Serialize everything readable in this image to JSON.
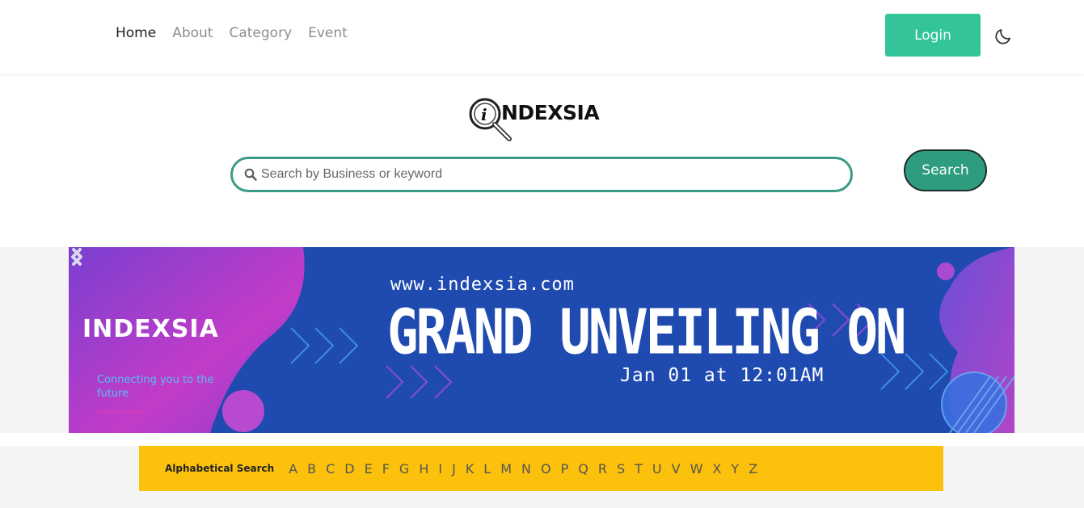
{
  "nav": {
    "items": [
      {
        "label": "Home",
        "active": true
      },
      {
        "label": "About",
        "active": false
      },
      {
        "label": "Category",
        "active": false
      },
      {
        "label": "Event",
        "active": false
      }
    ],
    "login_label": "Login",
    "theme_icon": "moon-icon"
  },
  "logo": {
    "text": "NDEXSIA",
    "icon": "magnifier-i-icon"
  },
  "search": {
    "placeholder": "Search by Business or keyword",
    "value": "",
    "button_label": "Search",
    "icon": "search-icon"
  },
  "banner": {
    "brand": "INDEXSIA",
    "tagline": "Connecting you to the future",
    "url": "www.indexsia.com",
    "headline": "GRAND UNVEILING ON",
    "date": "Jan 01 at 12:01AM",
    "prev_icon": "chevron-left-icon",
    "next_icon": "chevron-right-icon"
  },
  "alphabet": {
    "label": "Alphabetical Search",
    "letters": [
      "A",
      "B",
      "C",
      "D",
      "E",
      "F",
      "G",
      "H",
      "I",
      "J",
      "K",
      "L",
      "M",
      "N",
      "O",
      "P",
      "Q",
      "R",
      "S",
      "T",
      "U",
      "V",
      "W",
      "X",
      "Y",
      "Z"
    ]
  },
  "colors": {
    "accent": "#33c49a",
    "search_border": "#3a9a86",
    "search_button": "#2d9c7f",
    "banner_bg": "#1f4ab0",
    "banner_magenta": "#c23cc8",
    "alpha_bar": "#fcc10d"
  }
}
